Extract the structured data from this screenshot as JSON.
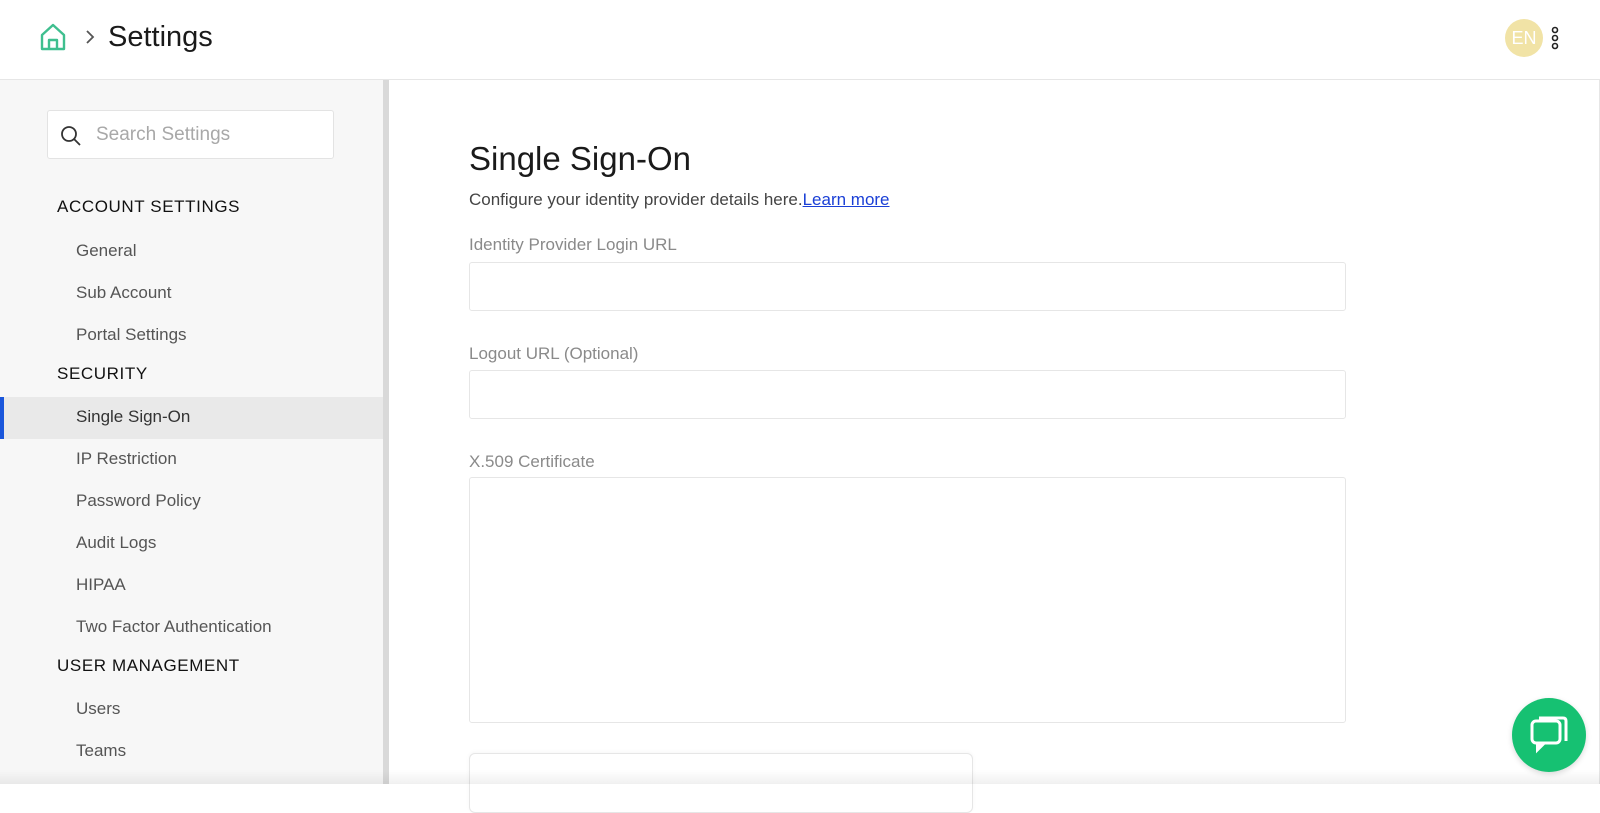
{
  "header": {
    "breadcrumb_title": "Settings",
    "avatar_initials": "EN",
    "avatar_color": "#f1e3a6",
    "home_icon": "home-icon",
    "menu_icon": "kebab-menu-icon"
  },
  "sidebar": {
    "search": {
      "placeholder": "Search Settings",
      "value": ""
    },
    "sections": [
      {
        "heading": "ACCOUNT SETTINGS",
        "items": [
          "General",
          "Sub Account",
          "Portal Settings"
        ]
      },
      {
        "heading": "SECURITY",
        "items": [
          "Single Sign-On",
          "IP Restriction",
          "Password Policy",
          "Audit Logs",
          "HIPAA",
          "Two Factor Authentication"
        ]
      },
      {
        "heading": "USER MANAGEMENT",
        "items": [
          "Users",
          "Teams"
        ]
      }
    ],
    "active_item": "Single Sign-On",
    "accent_color": "#1a56db"
  },
  "main": {
    "title": "Single Sign-On",
    "description": "Configure your identity provider details here.",
    "learn_more": "Learn more",
    "fields": {
      "idp_login_url": {
        "label": "Identity Provider Login URL",
        "value": ""
      },
      "logout_url": {
        "label": "Logout URL (Optional)",
        "value": ""
      },
      "certificate": {
        "label": "X.509 Certificate",
        "value": ""
      }
    }
  },
  "chat": {
    "icon": "chat-bubble-icon",
    "color": "#16c172"
  }
}
